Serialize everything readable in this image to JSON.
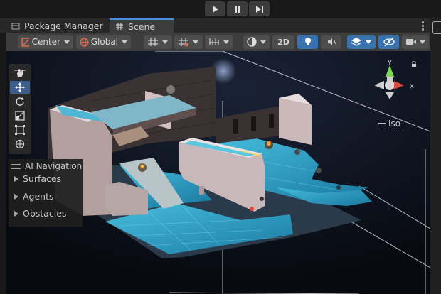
{
  "playbar": {
    "buttons": [
      {
        "name": "play-button",
        "icon": "play-icon"
      },
      {
        "name": "pause-button",
        "icon": "pause-icon"
      },
      {
        "name": "step-button",
        "icon": "step-icon"
      }
    ]
  },
  "tabs": [
    {
      "label": "Package Manager",
      "icon": "package-manager-icon",
      "active": false
    },
    {
      "label": "Scene",
      "icon": "scene-grid-icon",
      "active": true
    }
  ],
  "toolbar": {
    "pivot_label": "Center",
    "space_label": "Global",
    "mode_2d_label": "2D"
  },
  "gizmo": {
    "y_label": "y",
    "x_label": "x",
    "projection_label": "Iso"
  },
  "ai_navigation": {
    "title": "AI Navigation",
    "items": [
      "Surfaces",
      "Agents",
      "Obstacles"
    ]
  },
  "colors": {
    "accent": "#4a90e2",
    "water": "#2fb8d8",
    "stone": "#b8a8a8",
    "axis_x": "#e04a3a",
    "axis_y": "#7ed957"
  }
}
